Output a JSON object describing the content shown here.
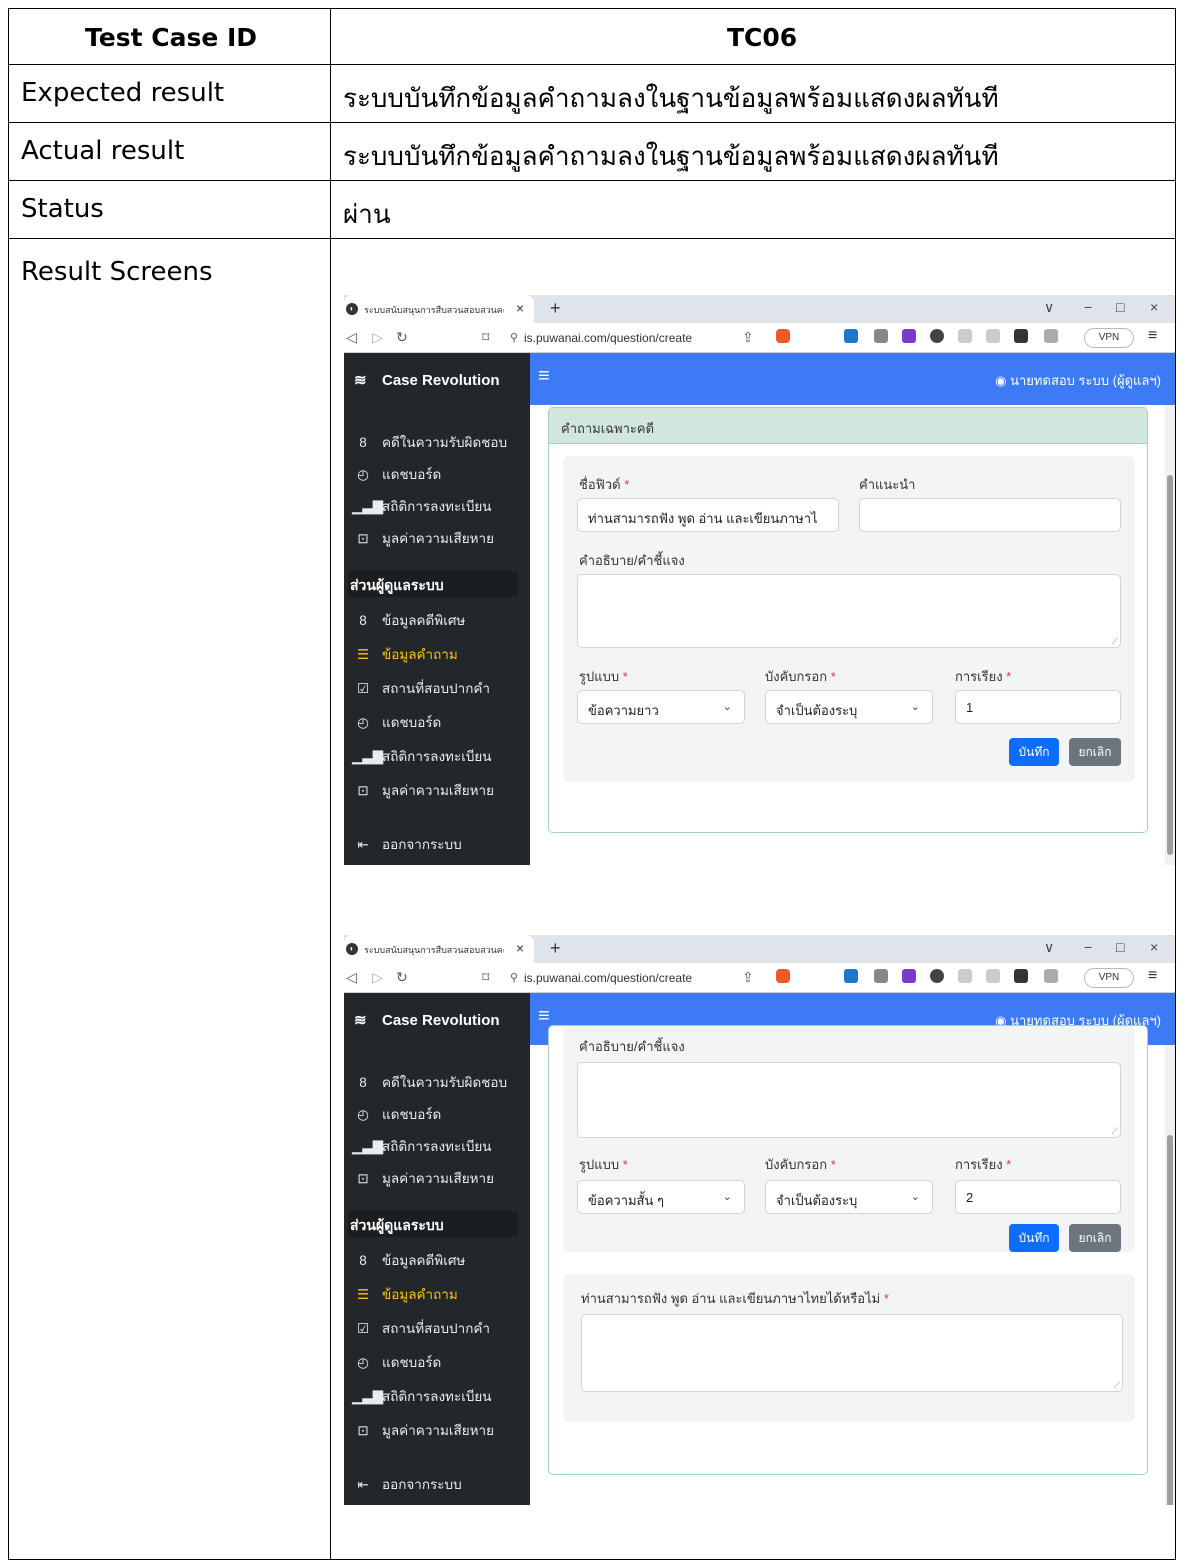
{
  "test_case": {
    "id_label": "Test Case ID",
    "id_value": "TC06",
    "expected_label": "Expected result",
    "expected_value": "ระบบบันทึกข้อมูลคำถามลงในฐานข้อมูลพร้อมแสดงผลทันที",
    "actual_label": "Actual result",
    "actual_value": "ระบบบันทึกข้อมูลคำถามลงในฐานข้อมูลพร้อมแสดงผลทันที",
    "status_label": "Status",
    "status_value": "ผ่าน",
    "screens_label": "Result Screens"
  },
  "browser": {
    "tab_title": "ระบบสนับสนุนการสืบสวนสอบสวนคดีพิเ",
    "tab_close": "×",
    "new_tab": "+",
    "url": "is.puwanai.com/question/create",
    "vpn": "VPN",
    "win_min": "−",
    "win_max": "□",
    "win_close": "×",
    "win_dropdown": "∨"
  },
  "app": {
    "brand": "Case Revolution",
    "user": "นายทดสอบ ระบบ (ผู้ดูแลฯ)",
    "nav_top": [
      {
        "label": "คดีในความรับผิดชอบ",
        "icon": "group-icon"
      },
      {
        "label": "แดชบอร์ด",
        "icon": "chart-pie-icon"
      },
      {
        "label": "สถิติการลงทะเบียน",
        "icon": "bar-chart-icon"
      },
      {
        "label": "มูลค่าความเสียหาย",
        "icon": "money-icon"
      }
    ],
    "section_admin": "ส่วนผู้ดูแลระบบ",
    "nav_admin": [
      {
        "label": "ข้อมูลคดีพิเศษ",
        "icon": "group-icon"
      },
      {
        "label": "ข้อมูลคำถาม",
        "icon": "message-icon"
      },
      {
        "label": "สถานที่สอบปากคำ",
        "icon": "checklist-icon"
      },
      {
        "label": "แดชบอร์ด",
        "icon": "chart-pie-icon"
      },
      {
        "label": "สถิติการลงทะเบียน",
        "icon": "bar-chart-icon"
      },
      {
        "label": "มูลค่าความเสียหาย",
        "icon": "money-icon"
      }
    ],
    "logout": "ออกจากระบบ"
  },
  "screen1": {
    "card_title": "คำถามเฉพาะคดี",
    "field_name_label": "ชื่อฟิวด์",
    "field_name_value": "ท่านสามารถฟัง พูด อ่าน และเขียนภาษาไ",
    "hint_label": "คำแนะนำ",
    "hint_value": "",
    "desc_label": "คำอธิบาย/คำชี้แจง",
    "type_label": "รูปแบบ",
    "type_value": "ข้อความยาว",
    "required_label": "บังคับกรอก",
    "required_value": "จำเป็นต้องระบุ",
    "order_label": "การเรียง",
    "order_value": "1",
    "save": "บันทึก",
    "cancel": "ยกเลิก",
    "req_mark": "*"
  },
  "screen2": {
    "desc_label": "คำอธิบาย/คำชี้แจง",
    "type_label": "รูปแบบ",
    "type_value": "ข้อความสั้น ๆ",
    "required_label": "บังคับกรอก",
    "required_value": "จำเป็นต้องระบุ",
    "order_label": "การเรียง",
    "order_value": "2",
    "save": "บันทึก",
    "cancel": "ยกเลิก",
    "preview_question": "ท่านสามารถฟัง พูด อ่าน และเขียนภาษาไทยได้หรือไม่",
    "req_mark": "*"
  }
}
